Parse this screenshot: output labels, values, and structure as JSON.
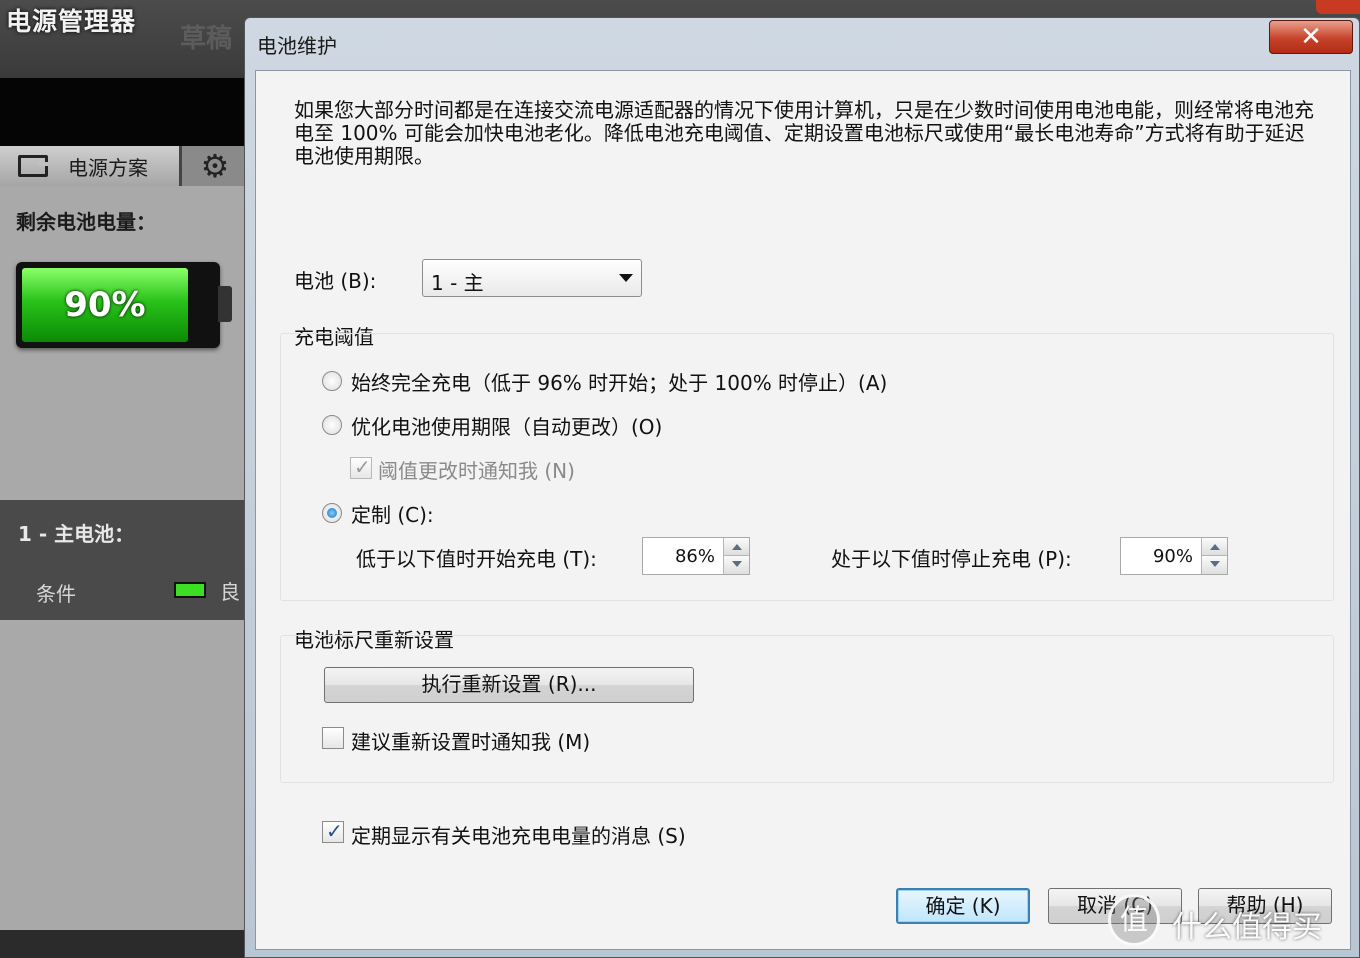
{
  "background_app": {
    "title": "电源管理器",
    "ghost_text": "草稿",
    "tab_label": "电源方案",
    "remaining_label": "剩余电池电量：",
    "battery_percent": "90%",
    "battery_level": 0.9,
    "section_title": "1 - 主电池：",
    "condition_label": "条件",
    "condition_value": "良"
  },
  "dialog": {
    "title": "电池维护",
    "close_glyph": "✕",
    "description": "如果您大部分时间都是在连接交流电源适配器的情况下使用计算机，只是在少数时间使用电池电能，则经常将电池充电至 100% 可能会加快电池老化。降低电池充电阈值、定期设置电池标尺或使用“最长电池寿命”方式将有助于延迟电池使用期限。",
    "battery_label": "电池 (B):",
    "battery_selected": "1 - 主",
    "threshold_group": {
      "title": "充电阈值",
      "option_full": "始终完全充电（低于 96% 时开始；处于 100% 时停止）(A)",
      "option_optimize": "优化电池使用期限（自动更改）(O)",
      "notify_change": "阈值更改时通知我 (N)",
      "option_custom": "定制 (C):",
      "start_label": "低于以下值时开始充电 (T):",
      "start_value": "86%",
      "stop_label": "处于以下值时停止充电 (P):",
      "stop_value": "90%"
    },
    "gauge_group": {
      "title": "电池标尺重新设置",
      "reset_button": "执行重新设置 (R)...",
      "notify_reset": "建议重新设置时通知我 (M)"
    },
    "periodic_message": "定期显示有关电池充电电量的消息 (S)",
    "buttons": {
      "ok": "确定 (K)",
      "cancel": "取消 (C)",
      "help": "帮助 (H)"
    }
  },
  "watermark": {
    "glyph": "值",
    "text": "什么值得买"
  }
}
